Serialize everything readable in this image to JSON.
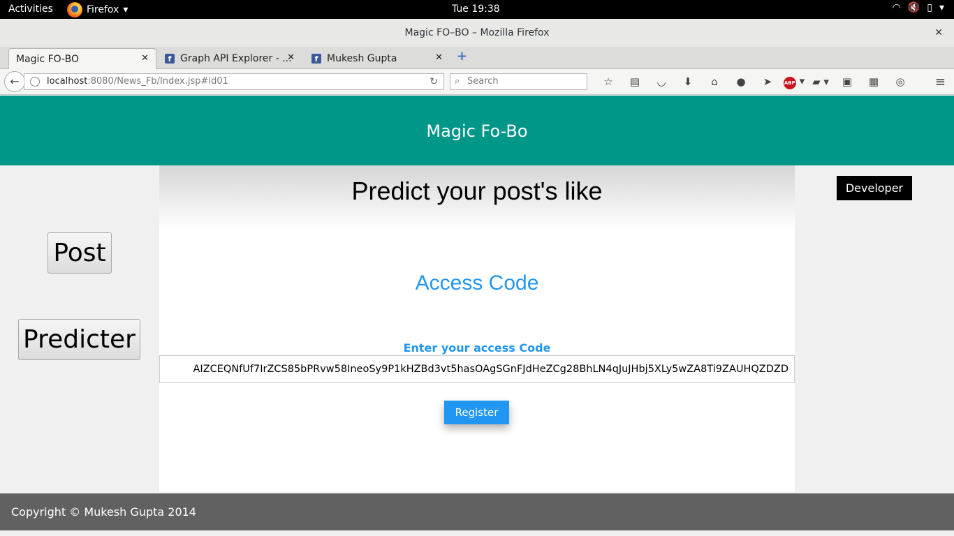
{
  "system_bar": {
    "activities": "Activities",
    "app_name": "Firefox",
    "clock": "Tue 19:38"
  },
  "window": {
    "title": "Magic FO–BO – Mozilla Firefox"
  },
  "tabs": [
    {
      "label": "Magic FO-BO",
      "active": true
    },
    {
      "label": "Graph API Explorer - ...",
      "active": false
    },
    {
      "label": "Mukesh Gupta",
      "active": false
    }
  ],
  "navbar": {
    "url_host": "localhost",
    "url_rest": ":8080/News_Fb/Index.jsp#id01",
    "search_placeholder": "Search"
  },
  "page": {
    "header_title": "Magic Fo-Bo",
    "main_title": "Predict your post's like",
    "section_title": "Access Code",
    "input_label": "Enter your access Code",
    "access_code_value": "AIZCEQNfUf7IrZCS85bPRvw58IneoSy9P1kHZBd3vt5hasOAgSGnFJdHeZCg28BhLN4qJuJHbj5XLy5wZA8Ti9ZAUHQZDZD",
    "register_label": "Register",
    "post_button": "Post",
    "predicter_button": "Predicter",
    "developer_button": "Developer",
    "footer_text": "Copyright © Mukesh Gupta 2014"
  }
}
